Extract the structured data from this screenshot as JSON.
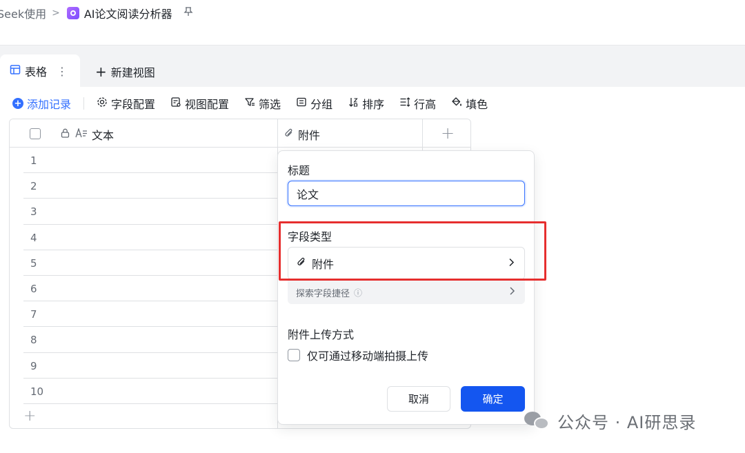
{
  "breadcrumb": {
    "parent": "Seek使用",
    "separator": ">",
    "title": "AI论文阅读分析器"
  },
  "tabs": {
    "active": "表格",
    "more": "⋮",
    "new_view": "新建视图"
  },
  "toolbar": {
    "add_record": "添加记录",
    "field_config": "字段配置",
    "view_config": "视图配置",
    "filter": "筛选",
    "group": "分组",
    "sort": "排序",
    "row_height": "行高",
    "fill_color": "填色"
  },
  "grid": {
    "columns": [
      {
        "name": "文本",
        "type": "text"
      },
      {
        "name": "附件",
        "type": "attachment"
      }
    ],
    "row_numbers": [
      "1",
      "2",
      "3",
      "4",
      "5",
      "6",
      "7",
      "8",
      "9",
      "10"
    ],
    "add_column": "+",
    "add_row": "+"
  },
  "panel": {
    "title_label": "标题",
    "title_value": "论文",
    "field_type_label": "字段类型",
    "field_type_value": "附件",
    "shortcut_label": "探索字段捷径",
    "upload_label": "附件上传方式",
    "mobile_only_label": "仅可通过移动端拍摄上传",
    "mobile_only_checked": false,
    "cancel_label": "取消",
    "confirm_label": "确定"
  },
  "watermark": {
    "text": "公众号 · AI研思录"
  },
  "colors": {
    "accent": "#3370ff",
    "confirm": "#1456f0",
    "highlight": "#e62e2e"
  }
}
